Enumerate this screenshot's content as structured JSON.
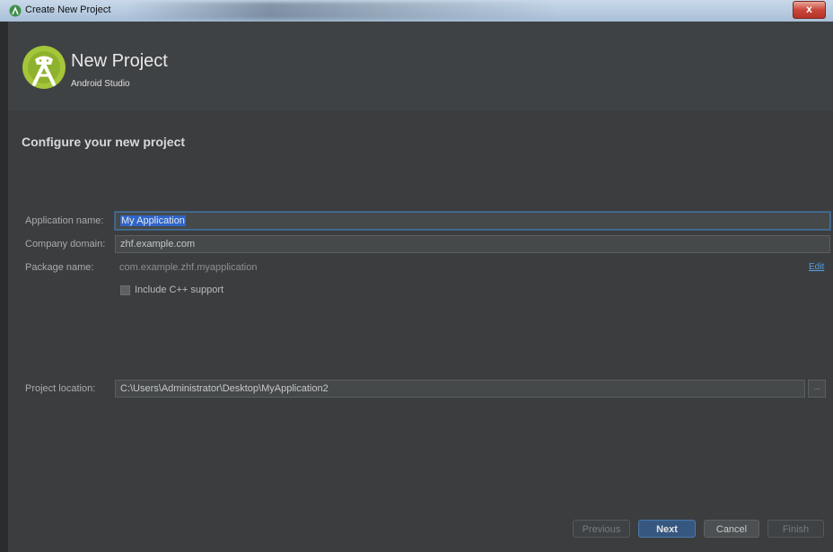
{
  "window": {
    "title": "Create New Project",
    "close_glyph": "x"
  },
  "header": {
    "title": "New Project",
    "subtitle": "Android Studio"
  },
  "section_title": "Configure your new project",
  "form": {
    "app_name": {
      "label": "Application name:",
      "value": "My Application"
    },
    "company_domain": {
      "label": "Company domain:",
      "value": "zhf.example.com"
    },
    "package_name": {
      "label": "Package name:",
      "value": "com.example.zhf.myapplication",
      "edit_label": "Edit"
    },
    "cpp_support": {
      "label": "Include C++ support",
      "checked": false
    },
    "project_location": {
      "label": "Project location:",
      "value": "C:\\Users\\Administrator\\Desktop\\MyApplication2",
      "browse_label": "..."
    }
  },
  "buttons": {
    "previous": "Previous",
    "next": "Next",
    "cancel": "Cancel",
    "finish": "Finish"
  },
  "colors": {
    "background": "#3b3d3f",
    "header": "#3f4244",
    "accent": "#365880",
    "logo_green": "#a4c639"
  }
}
